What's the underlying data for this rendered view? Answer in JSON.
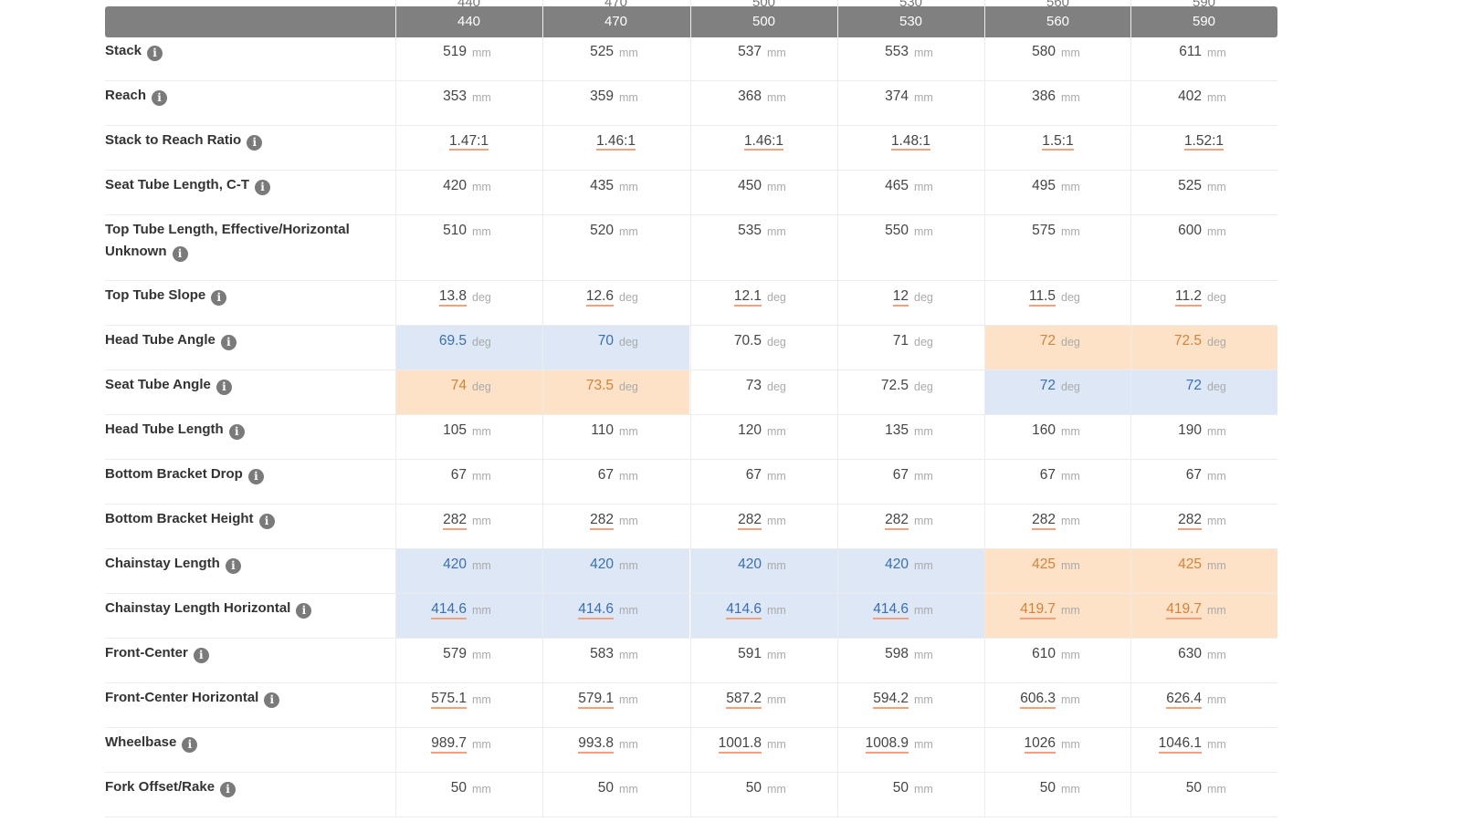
{
  "sizes": [
    "440",
    "470",
    "500",
    "530",
    "560",
    "590"
  ],
  "info_glyph": "i",
  "colors": {
    "header": "#808080",
    "highlight_low": "#dde7f6",
    "highlight_high": "#fde2c8",
    "text_low": "#3a6fb0",
    "text_high": "#d4823a"
  },
  "rows": [
    {
      "label": "Stack",
      "unit": "mm",
      "values": [
        "519",
        "525",
        "537",
        "553",
        "580",
        "611"
      ],
      "hl": [
        "n",
        "n",
        "n",
        "n",
        "n",
        "n"
      ],
      "underline": false
    },
    {
      "label": "Reach",
      "unit": "mm",
      "values": [
        "353",
        "359",
        "368",
        "374",
        "386",
        "402"
      ],
      "hl": [
        "n",
        "n",
        "n",
        "n",
        "n",
        "n"
      ],
      "underline": false
    },
    {
      "label": "Stack to Reach Ratio",
      "unit": "",
      "values": [
        "1.47:1",
        "1.46:1",
        "1.46:1",
        "1.48:1",
        "1.5:1",
        "1.52:1"
      ],
      "hl": [
        "n",
        "n",
        "n",
        "n",
        "n",
        "n"
      ],
      "underline": true,
      "ratio": true
    },
    {
      "label": "Seat Tube Length, C-T",
      "unit": "mm",
      "values": [
        "420",
        "435",
        "450",
        "465",
        "495",
        "525"
      ],
      "hl": [
        "n",
        "n",
        "n",
        "n",
        "n",
        "n"
      ],
      "underline": false
    },
    {
      "label": "Top Tube Length, Effective/Horizontal Unknown",
      "unit": "mm",
      "values": [
        "510",
        "520",
        "535",
        "550",
        "575",
        "600"
      ],
      "hl": [
        "n",
        "n",
        "n",
        "n",
        "n",
        "n"
      ],
      "underline": false,
      "tall": true
    },
    {
      "label": "Top Tube Slope",
      "unit": "deg",
      "values": [
        "13.8",
        "12.6",
        "12.1",
        "12",
        "11.5",
        "11.2"
      ],
      "hl": [
        "n",
        "n",
        "n",
        "n",
        "n",
        "n"
      ],
      "underline": true
    },
    {
      "label": "Head Tube Angle",
      "unit": "deg",
      "values": [
        "69.5",
        "70",
        "70.5",
        "71",
        "72",
        "72.5"
      ],
      "hl": [
        "b",
        "b",
        "n",
        "n",
        "o",
        "o"
      ],
      "underline": false
    },
    {
      "label": "Seat Tube Angle",
      "unit": "deg",
      "values": [
        "74",
        "73.5",
        "73",
        "72.5",
        "72",
        "72"
      ],
      "hl": [
        "o",
        "o",
        "n",
        "n",
        "b",
        "b"
      ],
      "underline": false
    },
    {
      "label": "Head Tube Length",
      "unit": "mm",
      "values": [
        "105",
        "110",
        "120",
        "135",
        "160",
        "190"
      ],
      "hl": [
        "n",
        "n",
        "n",
        "n",
        "n",
        "n"
      ],
      "underline": false
    },
    {
      "label": "Bottom Bracket Drop",
      "unit": "mm",
      "values": [
        "67",
        "67",
        "67",
        "67",
        "67",
        "67"
      ],
      "hl": [
        "n",
        "n",
        "n",
        "n",
        "n",
        "n"
      ],
      "underline": false
    },
    {
      "label": "Bottom Bracket Height",
      "unit": "mm",
      "values": [
        "282",
        "282",
        "282",
        "282",
        "282",
        "282"
      ],
      "hl": [
        "n",
        "n",
        "n",
        "n",
        "n",
        "n"
      ],
      "underline": true
    },
    {
      "label": "Chainstay Length",
      "unit": "mm",
      "values": [
        "420",
        "420",
        "420",
        "420",
        "425",
        "425"
      ],
      "hl": [
        "b",
        "b",
        "b",
        "b",
        "o",
        "o"
      ],
      "underline": false
    },
    {
      "label": "Chainstay Length Horizontal",
      "unit": "mm",
      "values": [
        "414.6",
        "414.6",
        "414.6",
        "414.6",
        "419.7",
        "419.7"
      ],
      "hl": [
        "b",
        "b",
        "b",
        "b",
        "o",
        "o"
      ],
      "underline": true
    },
    {
      "label": "Front-Center",
      "unit": "mm",
      "values": [
        "579",
        "583",
        "591",
        "598",
        "610",
        "630"
      ],
      "hl": [
        "n",
        "n",
        "n",
        "n",
        "n",
        "n"
      ],
      "underline": false
    },
    {
      "label": "Front-Center Horizontal",
      "unit": "mm",
      "values": [
        "575.1",
        "579.1",
        "587.2",
        "594.2",
        "606.3",
        "626.4"
      ],
      "hl": [
        "n",
        "n",
        "n",
        "n",
        "n",
        "n"
      ],
      "underline": true
    },
    {
      "label": "Wheelbase",
      "unit": "mm",
      "values": [
        "989.7",
        "993.8",
        "1001.8",
        "1008.9",
        "1026",
        "1046.1"
      ],
      "hl": [
        "n",
        "n",
        "n",
        "n",
        "n",
        "n"
      ],
      "underline": true
    },
    {
      "label": "Fork Offset/Rake",
      "unit": "mm",
      "values": [
        "50",
        "50",
        "50",
        "50",
        "50",
        "50"
      ],
      "hl": [
        "n",
        "n",
        "n",
        "n",
        "n",
        "n"
      ],
      "underline": false
    }
  ]
}
